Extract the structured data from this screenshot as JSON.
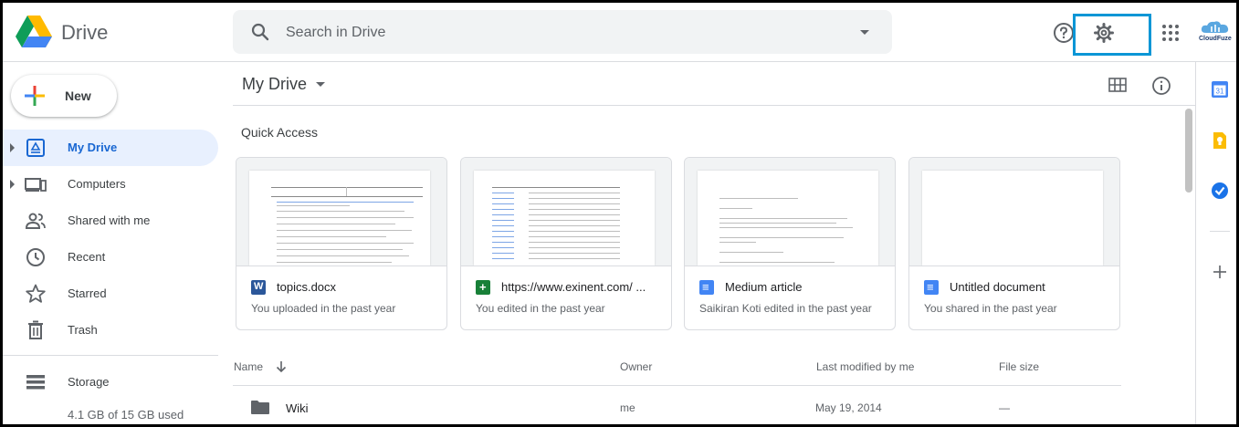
{
  "header": {
    "brand": "Drive",
    "search_placeholder": "Search in Drive",
    "account_label": "CloudFuze"
  },
  "sidebar": {
    "new_label": "New",
    "items": [
      {
        "label": "My Drive",
        "icon": "drive-folder-icon",
        "active": true
      },
      {
        "label": "Computers",
        "icon": "computers-icon"
      },
      {
        "label": "Shared with me",
        "icon": "people-icon"
      },
      {
        "label": "Recent",
        "icon": "clock-icon"
      },
      {
        "label": "Starred",
        "icon": "star-icon"
      },
      {
        "label": "Trash",
        "icon": "trash-icon"
      }
    ],
    "storage": {
      "label": "Storage",
      "usage": "4.1 GB of 15 GB used"
    }
  },
  "main": {
    "title": "My Drive",
    "quick_access_title": "Quick Access",
    "cards": [
      {
        "name": "topics.docx",
        "subtitle": "You uploaded in the past year",
        "icon": "word-icon",
        "icon_color": "#2b579a",
        "icon_letter": "W"
      },
      {
        "name": "https://www.exinent.com/ ...",
        "subtitle": "You edited in the past year",
        "icon": "sheets-icon",
        "icon_color": "#188038",
        "icon_letter": "+"
      },
      {
        "name": "Medium article",
        "subtitle": "Saikiran Koti edited in the past year",
        "icon": "docs-icon",
        "icon_color": "#4285f4",
        "icon_letter": "≡"
      },
      {
        "name": "Untitled document",
        "subtitle": "You shared in the past year",
        "icon": "docs-icon",
        "icon_color": "#4285f4",
        "icon_letter": "≡"
      }
    ],
    "table": {
      "columns": [
        "Name",
        "Owner",
        "Last modified by me",
        "File size"
      ],
      "rows": [
        {
          "name": "Wiki",
          "owner": "me",
          "modified": "May 19, 2014",
          "size": "—"
        }
      ]
    }
  },
  "colors": {
    "accent": "#1967d2",
    "active_bg": "#e8f0fe",
    "highlight_box": "#0b96d6"
  }
}
